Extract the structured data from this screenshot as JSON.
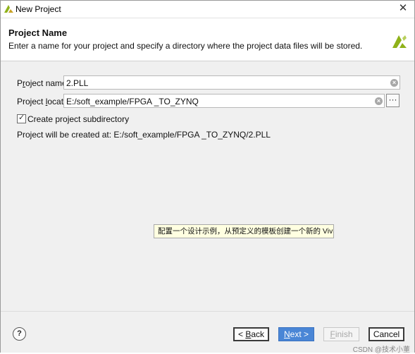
{
  "window": {
    "title": "New Project",
    "close_label": "✕"
  },
  "header": {
    "title": "Project Name",
    "description": "Enter a name for your project and specify a directory where the project data files will be stored."
  },
  "form": {
    "project_name_label_pre": "P",
    "project_name_label_ul": "r",
    "project_name_label_post": "oject name:",
    "project_name_value": "2.PLL",
    "project_location_label_pre": "Project ",
    "project_location_label_ul": "l",
    "project_location_label_post": "ocation:",
    "project_location_value": "E:/soft_example/FPGA _TO_ZYNQ",
    "browse_label": "···",
    "subdirectory_label": "Create project subdirectory",
    "subdirectory_checked": true,
    "created_at_text": "Project will be created at: E:/soft_example/FPGA _TO_ZYNQ/2.PLL"
  },
  "tooltip": {
    "text": "配置一个设计示例，从预定义的模板创建一个新的 Vivado 项目"
  },
  "footer": {
    "help_label": "?",
    "back_label_pre": "< ",
    "back_label_ul": "B",
    "back_label_post": "ack",
    "next_label_ul": "N",
    "next_label_post": "ext >",
    "finish_label_ul": "F",
    "finish_label_post": "inish",
    "cancel_label": "Cancel"
  },
  "watermark": "CSDN @技术小董",
  "colors": {
    "accent": "#4a86d6",
    "logo": "#8fb21a",
    "tooltip_bg": "#ffffe1"
  }
}
